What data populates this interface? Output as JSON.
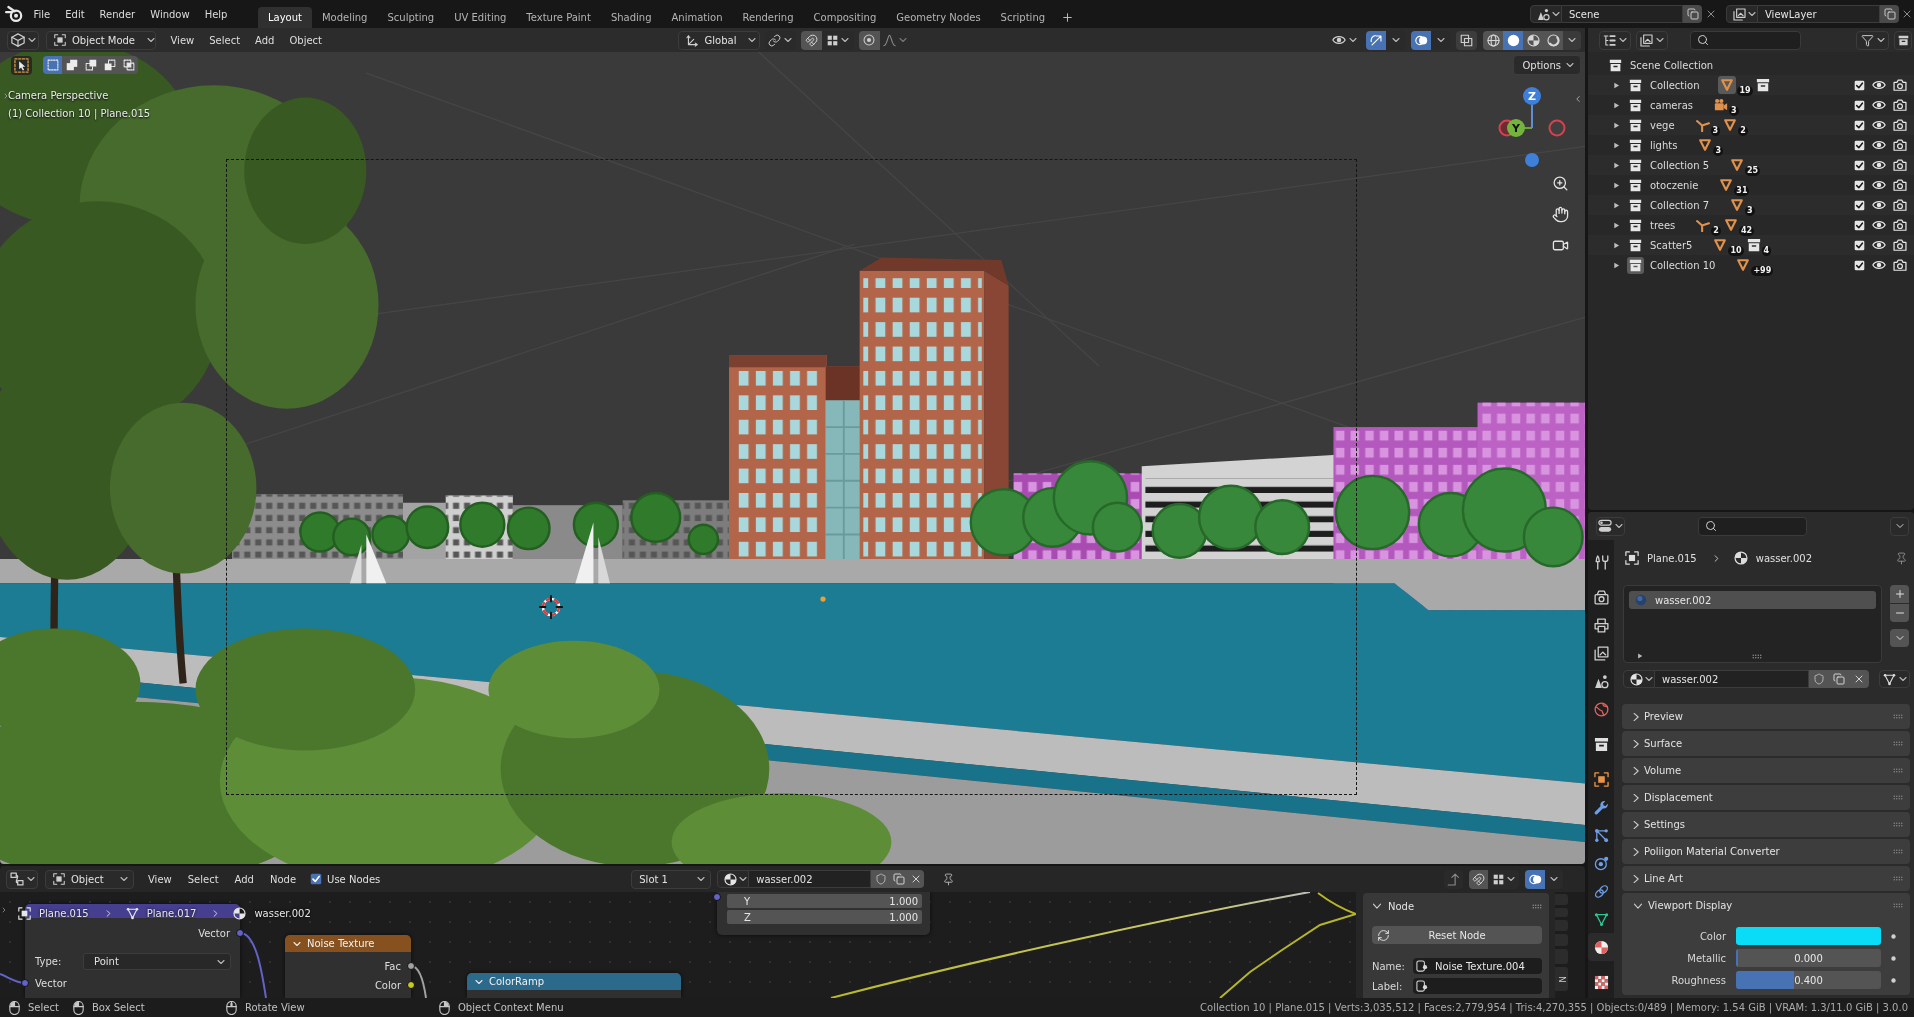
{
  "topbar": {
    "menus": [
      "File",
      "Edit",
      "Render",
      "Window",
      "Help"
    ],
    "workspaces": [
      {
        "label": "Layout",
        "selected": true
      },
      {
        "label": "Modeling",
        "selected": false
      },
      {
        "label": "Sculpting",
        "selected": false
      },
      {
        "label": "UV Editing",
        "selected": false
      },
      {
        "label": "Texture Paint",
        "selected": false
      },
      {
        "label": "Shading",
        "selected": false
      },
      {
        "label": "Animation",
        "selected": false
      },
      {
        "label": "Rendering",
        "selected": false
      },
      {
        "label": "Compositing",
        "selected": false
      },
      {
        "label": "Geometry Nodes",
        "selected": false
      },
      {
        "label": "Scripting",
        "selected": false
      }
    ],
    "scene": "Scene",
    "view_layer": "ViewLayer"
  },
  "viewport": {
    "header": {
      "mode": "Object Mode",
      "menus": [
        "View",
        "Select",
        "Add",
        "Object"
      ],
      "orientation": "Global",
      "toggles": [
        {
          "kind": "visibility",
          "on": false
        },
        {
          "kind": "gizmo",
          "on": true
        },
        {
          "kind": "overlay",
          "on": true
        },
        {
          "kind": "xray",
          "on": false
        }
      ],
      "shading": [
        {
          "kind": "wireframe",
          "selected": false
        },
        {
          "kind": "solid",
          "selected": true
        },
        {
          "kind": "material",
          "selected": false
        },
        {
          "kind": "rendered",
          "selected": false
        }
      ]
    },
    "select_modes": [
      {
        "kind": "new",
        "selected": true
      },
      {
        "kind": "extend",
        "selected": false
      },
      {
        "kind": "subtract",
        "selected": false
      },
      {
        "kind": "invert",
        "selected": false
      },
      {
        "kind": "intersect",
        "selected": false
      }
    ],
    "options": "Options",
    "info": [
      "Camera Perspective",
      "(1) Collection 10 | Plane.015"
    ],
    "gizmo": [
      {
        "kind": "z",
        "label": "Z"
      },
      {
        "kind": "y",
        "label": "Y"
      }
    ]
  },
  "outliner": {
    "scene_collection": {
      "name": "Scene Collection",
      "children": [
        {
          "name": "Collection",
          "expanded": false,
          "active": false,
          "checked": true,
          "contents": [
            {
              "kind": "mesh",
              "count": "19",
              "active": true
            },
            {
              "kind": "collection",
              "active": false
            }
          ]
        },
        {
          "name": "cameras",
          "expanded": false,
          "active": false,
          "checked": true,
          "contents": [
            {
              "kind": "camera",
              "count": "3",
              "active": false
            }
          ]
        },
        {
          "name": "vege",
          "expanded": false,
          "active": false,
          "checked": true,
          "contents": [
            {
              "kind": "armature",
              "count": "3",
              "active": false
            },
            {
              "kind": "mesh",
              "count": "2",
              "active": false
            }
          ]
        },
        {
          "name": "lights",
          "expanded": false,
          "active": false,
          "checked": true,
          "contents": [
            {
              "kind": "mesh",
              "count": "3",
              "active": false
            }
          ]
        },
        {
          "name": "Collection 5",
          "expanded": false,
          "active": false,
          "checked": true,
          "contents": [
            {
              "kind": "mesh",
              "count": "25",
              "active": false
            }
          ]
        },
        {
          "name": "otoczenie",
          "expanded": false,
          "active": false,
          "checked": true,
          "contents": [
            {
              "kind": "mesh",
              "count": "31",
              "active": false
            }
          ]
        },
        {
          "name": "Collection 7",
          "expanded": false,
          "active": false,
          "checked": true,
          "contents": [
            {
              "kind": "mesh",
              "count": "3",
              "active": false
            }
          ]
        },
        {
          "name": "trees",
          "expanded": false,
          "active": false,
          "checked": true,
          "contents": [
            {
              "kind": "armature",
              "count": "2",
              "active": false
            },
            {
              "kind": "mesh",
              "count": "42",
              "active": false
            }
          ]
        },
        {
          "name": "Scatter5",
          "expanded": false,
          "active": false,
          "checked": true,
          "contents": [
            {
              "kind": "mesh",
              "count": "10",
              "active": false
            },
            {
              "kind": "collection",
              "count": "4",
              "active": false
            }
          ]
        },
        {
          "name": "Collection 10",
          "expanded": false,
          "active": true,
          "checked": true,
          "contents": [
            {
              "kind": "mesh",
              "count": "+99",
              "active": false
            }
          ]
        }
      ]
    }
  },
  "properties": {
    "tabs": [
      {
        "kind": "tool",
        "selected": false
      },
      {
        "kind": "render",
        "selected": false
      },
      {
        "kind": "output",
        "selected": false
      },
      {
        "kind": "view_layer",
        "selected": false
      },
      {
        "kind": "scene",
        "selected": false
      },
      {
        "kind": "world",
        "selected": false
      },
      {
        "kind": "collection",
        "selected": false
      },
      {
        "kind": "object",
        "selected": false
      },
      {
        "kind": "modifiers",
        "selected": false
      },
      {
        "kind": "particles",
        "selected": false
      },
      {
        "kind": "physics",
        "selected": false
      },
      {
        "kind": "constraints",
        "selected": false
      },
      {
        "kind": "data",
        "selected": false
      },
      {
        "kind": "material",
        "selected": true
      },
      {
        "kind": "texture",
        "selected": false
      }
    ],
    "breadcrumb": [
      {
        "kind": "object",
        "label": "Plane.015"
      },
      {
        "kind": "material",
        "label": "wasser.002"
      }
    ],
    "slots": [
      {
        "name": "wasser.002",
        "selected": true
      }
    ],
    "material": "wasser.002",
    "panels": [
      {
        "title": "Preview",
        "expanded": false
      },
      {
        "title": "Surface",
        "expanded": false
      },
      {
        "title": "Volume",
        "expanded": false
      },
      {
        "title": "Displacement",
        "expanded": false
      },
      {
        "title": "Settings",
        "expanded": false
      },
      {
        "title": "Poliigon Material Converter",
        "expanded": false
      },
      {
        "title": "Line Art",
        "expanded": false
      },
      {
        "title": "Viewport Display",
        "expanded": true,
        "fields": [
          {
            "kind": "color",
            "label": "Color",
            "color": "#0adcf7"
          },
          {
            "kind": "slider",
            "label": "Metallic",
            "value": "0.000",
            "level": 0
          },
          {
            "kind": "slider",
            "label": "Roughness",
            "value": "0.400",
            "level": 0.4
          }
        ]
      }
    ]
  },
  "node_editor": {
    "header": {
      "type": "Object",
      "menus": [
        "View",
        "Select",
        "Add",
        "Node"
      ],
      "use_nodes": {
        "label": "Use Nodes",
        "checked": true
      },
      "slot": "Slot 1",
      "material": "wasser.002",
      "overlay": {
        "on": true
      }
    },
    "breadcrumb": [
      {
        "kind": "object",
        "label": "Plane.015"
      },
      {
        "kind": "mesh",
        "label": "Plane.017"
      },
      {
        "kind": "material",
        "label": "wasser.002"
      }
    ],
    "nodes": [
      {
        "kind": "vector",
        "rows": [
          {
            "label": "Y",
            "value": "1.000"
          },
          {
            "label": "Z",
            "value": "1.000"
          }
        ]
      },
      {
        "kind": "mapping",
        "outputs": [
          {
            "label": "Vector",
            "kind": "vector"
          }
        ],
        "type": {
          "label": "Type:",
          "value": "Point"
        },
        "inputs": [
          {
            "label": "Vector",
            "kind": "vector"
          }
        ]
      },
      {
        "kind": "texture",
        "title": "Noise Texture",
        "outputs": [
          {
            "label": "Fac",
            "kind": "float"
          },
          {
            "label": "Color",
            "kind": "color"
          }
        ]
      },
      {
        "kind": "converter",
        "title": "ColorRamp"
      }
    ],
    "sidebar": {
      "panel": {
        "title": "Node",
        "expanded": true,
        "reset": "Reset Node",
        "fields": [
          {
            "label": "Name:",
            "value": "Noise Texture.004"
          },
          {
            "label": "Label:"
          }
        ]
      },
      "tab": "N"
    }
  },
  "status_bar": {
    "hints": [
      {
        "kind": "left",
        "label": "Select"
      },
      {
        "kind": "left_drag",
        "label": "Box Select"
      },
      {
        "kind": "middle",
        "label": "Rotate View"
      },
      {
        "kind": "right",
        "label": "Object Context Menu"
      }
    ],
    "stats": "Collection 10 | Plane.015 | Verts:3,035,512 | Faces:2,779,954 | Tris:4,270,355 | Objects:0/489 | Memory: 1.54 GiB | VRAM: 1.3/11.0 GiB | 3.0.0"
  }
}
